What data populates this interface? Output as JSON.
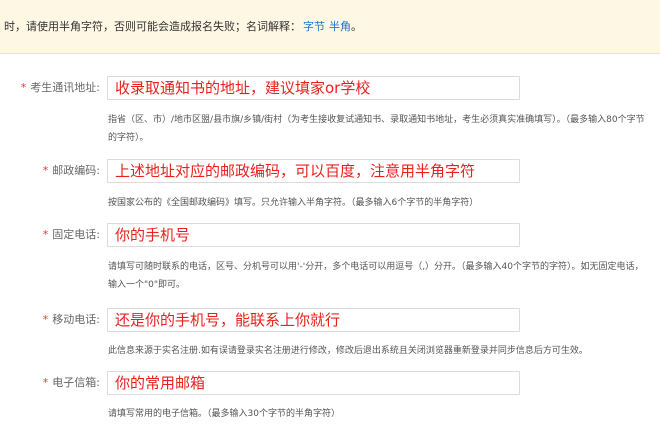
{
  "notice": {
    "text": "时，请使用半角字符，否则可能会造成报名失败；名词解释：",
    "link_byte": "字节",
    "link_halfwidth": "半角",
    "end": "。"
  },
  "fields": [
    {
      "required_mark": "*",
      "label": "考生通讯地址:",
      "value": "收录取通知书的地址，建议填家or学校",
      "hint": "指省（区、市）/地市区盟/县市旗/乡镇/街村（为考生接收复试通知书、录取通知书地址，考生必须真实准确填写）。（最多输入80个字节的字符）。"
    },
    {
      "required_mark": "*",
      "label": "邮政编码:",
      "value": "上述地址对应的邮政编码，可以百度，注意用半角字符",
      "hint": "按国家公布的《全国邮政编码》填写。只允许输入半角字符。（最多输入6个字节的半角字符）"
    },
    {
      "required_mark": "*",
      "label": "固定电话:",
      "value": "你的手机号",
      "hint": "请填写可随时联系的电话，区号、分机号可以用'-'分开，多个电话可以用逗号（,）分开。（最多输入40个字节的字符）。如无固定电话，输入一个\"0\"即可。"
    },
    {
      "required_mark": "*",
      "label": "移动电话:",
      "value": "还是你的手机号，能联系上你就行",
      "hint": "此信息来源于实名注册.如有误请登录实名注册进行修改，修改后退出系统且关闭浏览器重新登录并同步信息后方可生效。"
    },
    {
      "required_mark": "*",
      "label": "电子信箱:",
      "value": "你的常用邮箱",
      "hint": "请填写常用的电子信箱。（最多输入30个字节的半角字符）"
    }
  ]
}
